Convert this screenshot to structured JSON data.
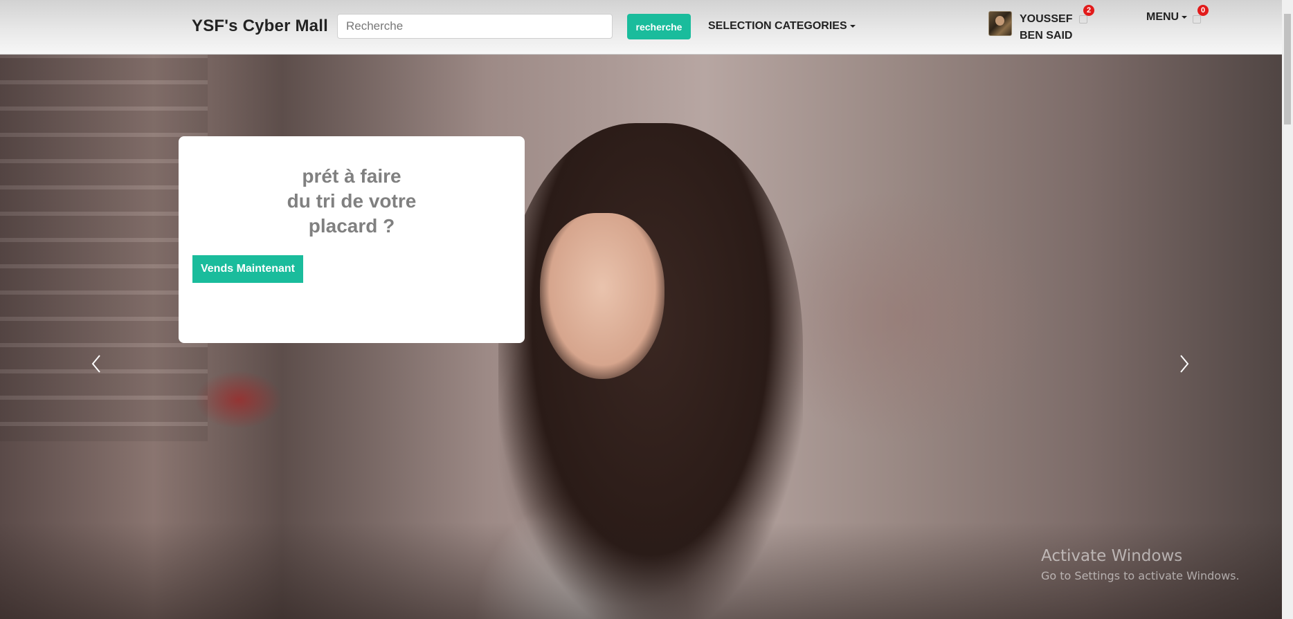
{
  "navbar": {
    "brand": "YSF's Cyber Mall",
    "search": {
      "placeholder": "Recherche",
      "value": ""
    },
    "search_button_label": "recherche",
    "categories_label": "SELECTION CATEGORIES",
    "user": {
      "name_line1": "YOUSSEF",
      "name_line2": "BEN SAID",
      "notification_count": "2"
    },
    "menu_label": "MENU",
    "cart_count": "0"
  },
  "hero": {
    "promo_line1": "prét à faire",
    "promo_line2": "du tri de votre",
    "promo_line3": "placard ?",
    "cta_label": "Vends Maintenant"
  },
  "watermark": {
    "title": "Activate Windows",
    "subtitle": "Go to Settings to activate Windows."
  },
  "colors": {
    "accent": "#1abc9c",
    "badge": "#e21b1b"
  }
}
